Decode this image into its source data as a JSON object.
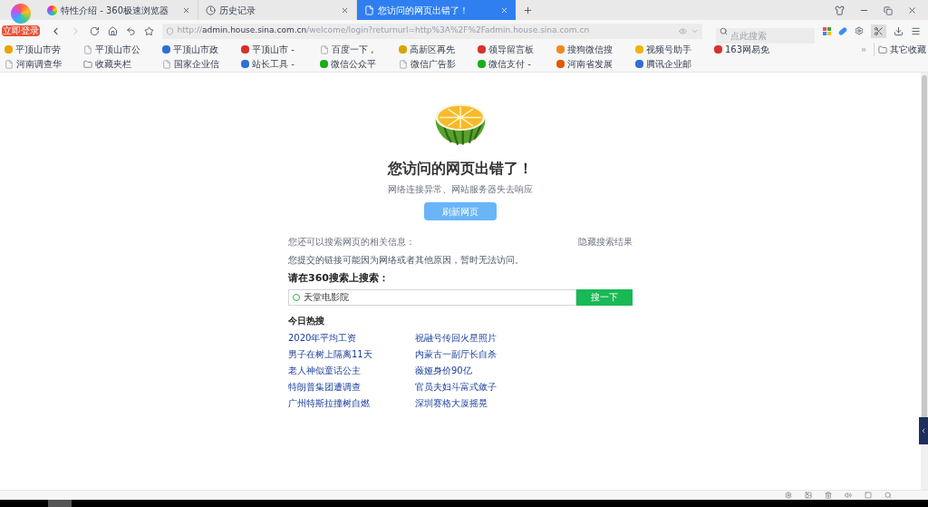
{
  "login_badge": "立即登录",
  "tabs": [
    {
      "title": "特性介绍 - 360极速浏览器",
      "kind": "colorful",
      "selected": false
    },
    {
      "title": "历史记录",
      "kind": "clock",
      "selected": false
    },
    {
      "title": "您访问的网页出错了！",
      "kind": "page",
      "selected": true
    }
  ],
  "address": {
    "prefix": "http://",
    "host": "admin.house.sina.com.cn",
    "path": "/welcome/login?returnurl=http%3A%2F%2Fadmin.house.sina.com.cn"
  },
  "search": {
    "placeholder": "点此搜索"
  },
  "bookmarks": [
    {
      "label": "平顶山市劳",
      "kind": "site",
      "color": "#e8a400"
    },
    {
      "label": "平顶山市公",
      "kind": "page"
    },
    {
      "label": "平顶山市政",
      "kind": "site",
      "color": "#2f6fd6"
    },
    {
      "label": "平顶山市 -",
      "kind": "site",
      "color": "#d9302b"
    },
    {
      "label": "百度一下 ,",
      "kind": "page"
    },
    {
      "label": "高新区再先",
      "kind": "site",
      "color": "#d9a400"
    },
    {
      "label": "领导留言板",
      "kind": "site",
      "color": "#d9302b"
    },
    {
      "label": "搜狗微信搜",
      "kind": "site",
      "color": "#f08a1c"
    },
    {
      "label": "视频号助手",
      "kind": "site",
      "color": "#f0b400"
    },
    {
      "label": "163网易免",
      "kind": "site",
      "color": "#d9302b"
    },
    {
      "label": "河南调查华",
      "kind": "page"
    },
    {
      "label": "收藏夹栏",
      "kind": "folder"
    },
    {
      "label": "国家企业信",
      "kind": "page"
    },
    {
      "label": "站长工具 -",
      "kind": "site",
      "color": "#2f6fd6"
    },
    {
      "label": "微信公众平",
      "kind": "site",
      "color": "#1aad19"
    },
    {
      "label": "微信广告影",
      "kind": "page"
    },
    {
      "label": "微信支付 -",
      "kind": "site",
      "color": "#1aad19"
    },
    {
      "label": "河南省发展",
      "kind": "site",
      "color": "#e05a00"
    },
    {
      "label": "腾讯企业邮",
      "kind": "site",
      "color": "#2f6fd6"
    }
  ],
  "bookmarks_more": "»",
  "other_bookmarks": "其它收藏",
  "error": {
    "title": "您访问的网页出错了！",
    "subtitle": "网络连接异常、网站服务器失去响应",
    "refresh_button": "刷新网页"
  },
  "related": {
    "heading": "您还可以搜索网页的相关信息：",
    "hide_link": "隐藏搜索结果",
    "reason": "您提交的链接可能因为网络或者其他原因，暂时无法访问。",
    "search_heading": "请在360搜索上搜索：",
    "search_value": "天堂电影院",
    "search_button": "搜一下"
  },
  "hot": {
    "heading": "今日热搜",
    "items": [
      "2020年平均工资",
      "祝融号传回火星照片",
      "男子在树上隔离11天",
      "内蒙古一副厅长自杀",
      "老人神似童话公主",
      "薇娅身价90亿",
      "特朗普集团遭调查",
      "官员夫妇斗富式敛子",
      "广州特斯拉撞树自燃",
      "深圳赛格大厦摇晃"
    ]
  }
}
